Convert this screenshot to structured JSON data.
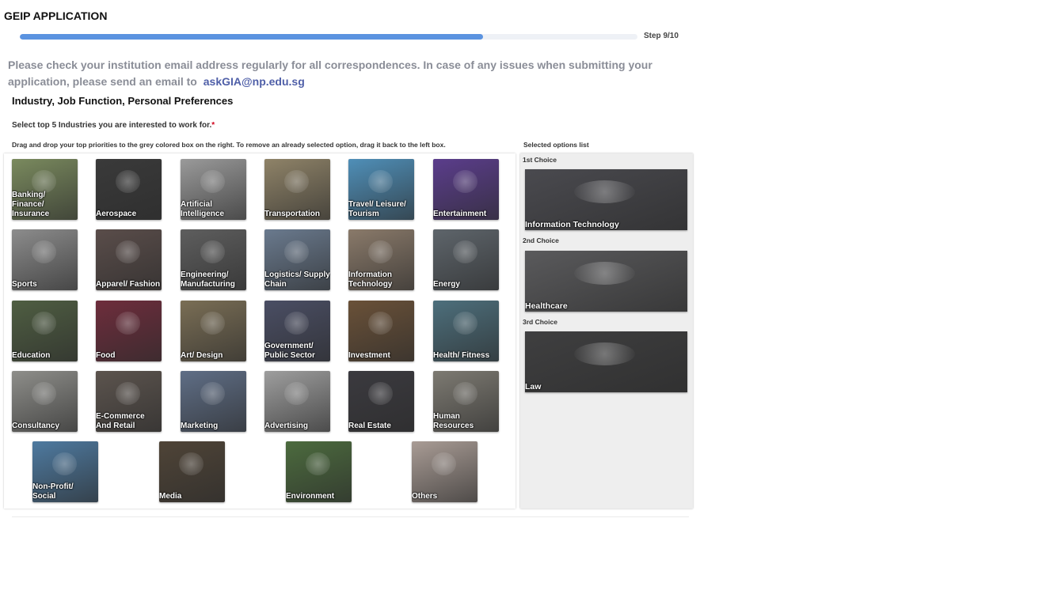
{
  "app": {
    "title": "GEIP APPLICATION"
  },
  "progress": {
    "step_label": "Step 9/10",
    "fraction": 0.75
  },
  "notice": {
    "text": "Please check your institution email address regularly for all correspondences. In case of any issues when submitting your application, please send an email to",
    "email": "askGIA@np.edu.sg"
  },
  "section": {
    "title": "Industry, Job Function, Personal Preferences"
  },
  "question": {
    "text": "Select top 5 Industries you are interested to work for.",
    "required_mark": "*"
  },
  "instructions": "Drag and drop your top priorities to the grey colored box on the right. To remove an already selected option, drag it back to the left box.",
  "selected": {
    "heading": "Selected options list",
    "choices": [
      {
        "rank": "1st Choice",
        "label": "Information Technology",
        "color": "#4a4a4f"
      },
      {
        "rank": "2nd Choice",
        "label": "Healthcare",
        "color": "#5a5a5c"
      },
      {
        "rank": "3rd Choice",
        "label": "Law",
        "color": "#3f3f40"
      }
    ]
  },
  "industries": [
    {
      "label": "Banking/ Finance/ Insurance",
      "color": "#7a8a5e",
      "icon": "coins-icon"
    },
    {
      "label": "Aerospace",
      "color": "#3a3a3a",
      "icon": "astronaut-icon"
    },
    {
      "label": "Artificial Intelligence",
      "color": "#9a9a9a",
      "icon": "robot-icon"
    },
    {
      "label": "Transportation",
      "color": "#8f8368",
      "icon": "car-icon"
    },
    {
      "label": "Travel/ Leisure/ Tourism",
      "color": "#4f8fb8",
      "icon": "beach-icon"
    },
    {
      "label": "Entertainment",
      "color": "#5b3d8c",
      "icon": "concert-icon"
    },
    {
      "label": "Sports",
      "color": "#8c8c8c",
      "icon": "ball-icon"
    },
    {
      "label": "Apparel/ Fashion",
      "color": "#5a4d4a",
      "icon": "dress-icon"
    },
    {
      "label": "Engineering/ Manufacturing",
      "color": "#5e5e5e",
      "icon": "gear-icon"
    },
    {
      "label": "Logistics/ Supply Chain",
      "color": "#6a7a8e",
      "icon": "ship-icon"
    },
    {
      "label": "Information Technology",
      "color": "#8a7a6a",
      "icon": "laptop-icon"
    },
    {
      "label": "Energy",
      "color": "#5e656b",
      "icon": "wind-turbine-icon"
    },
    {
      "label": "Education",
      "color": "#4f5e42",
      "icon": "book-icon"
    },
    {
      "label": "Food",
      "color": "#6e2d3c",
      "icon": "berries-icon"
    },
    {
      "label": "Art/ Design",
      "color": "#7a6e55",
      "icon": "palette-icon"
    },
    {
      "label": "Government/ Public Sector",
      "color": "#4a4e64",
      "icon": "parliament-icon"
    },
    {
      "label": "Investment",
      "color": "#6a5138",
      "icon": "clock-icon"
    },
    {
      "label": "Health/ Fitness",
      "color": "#4d6f7c",
      "icon": "dumbbell-icon"
    },
    {
      "label": "Consultancy",
      "color": "#8e8e8a",
      "icon": "laptop-icon"
    },
    {
      "label": "E-Commerce And Retail",
      "color": "#5c544e",
      "icon": "shop-icon"
    },
    {
      "label": "Marketing",
      "color": "#5f6e86",
      "icon": "newspaper-icon"
    },
    {
      "label": "Advertising",
      "color": "#9e9e9e",
      "icon": "megaphone-icon"
    },
    {
      "label": "Real Estate",
      "color": "#3b3a3f",
      "icon": "building-icon"
    },
    {
      "label": "Human Resources",
      "color": "#7d7a72",
      "icon": "people-icon"
    },
    {
      "label": "Non-Profit/ Social",
      "color": "#4e7aa0",
      "icon": "heart-icon"
    },
    {
      "label": "Media",
      "color": "#4f4437",
      "icon": "tv-icon"
    },
    {
      "label": "Environment",
      "color": "#4c6b3e",
      "icon": "tree-icon"
    },
    {
      "label": "Others",
      "color": "#a99c95",
      "icon": "dots-icon"
    }
  ]
}
